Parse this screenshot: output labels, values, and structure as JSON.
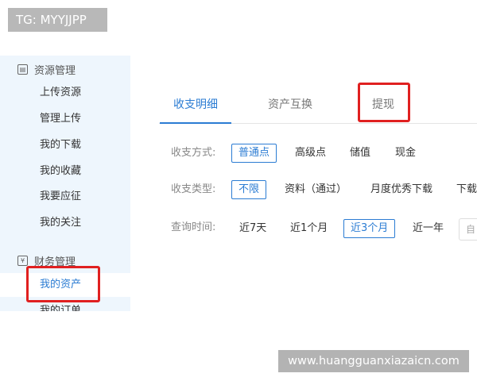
{
  "watermarks": {
    "top_left": "TG: MYYJJPP",
    "bottom_right": "www.huangguanxiazaicn.com"
  },
  "sidebar": {
    "section_resources": {
      "label": "资源管理",
      "icon": "folder-icon"
    },
    "resource_items": [
      {
        "label": "上传资源"
      },
      {
        "label": "管理上传"
      },
      {
        "label": "我的下载"
      },
      {
        "label": "我的收藏"
      },
      {
        "label": "我要应征"
      },
      {
        "label": "我的关注"
      }
    ],
    "section_finance": {
      "label": "财务管理",
      "icon": "yen-icon"
    },
    "finance_items": [
      {
        "label": "我的资产",
        "active": true
      },
      {
        "label": "我的订单"
      }
    ]
  },
  "tabs": [
    {
      "label": "收支明细",
      "active": true
    },
    {
      "label": "资产互换"
    },
    {
      "label": "提现"
    }
  ],
  "filters": {
    "payment_method": {
      "label": "收支方式:",
      "options": [
        "普通点",
        "高级点",
        "储值",
        "现金"
      ],
      "selected": "普通点"
    },
    "type": {
      "label": "收支类型:",
      "options": [
        "不限",
        "资料（通过）",
        "月度优秀下载",
        "下载"
      ],
      "selected": "不限"
    },
    "time": {
      "label": "查询时间:",
      "options": [
        "近7天",
        "近1个月",
        "近3个月",
        "近一年"
      ],
      "selected": "近3个月",
      "date_placeholder": "自"
    }
  },
  "annotations": {
    "highlight_color": "#e02020",
    "accent_color": "#2b7cd3"
  }
}
